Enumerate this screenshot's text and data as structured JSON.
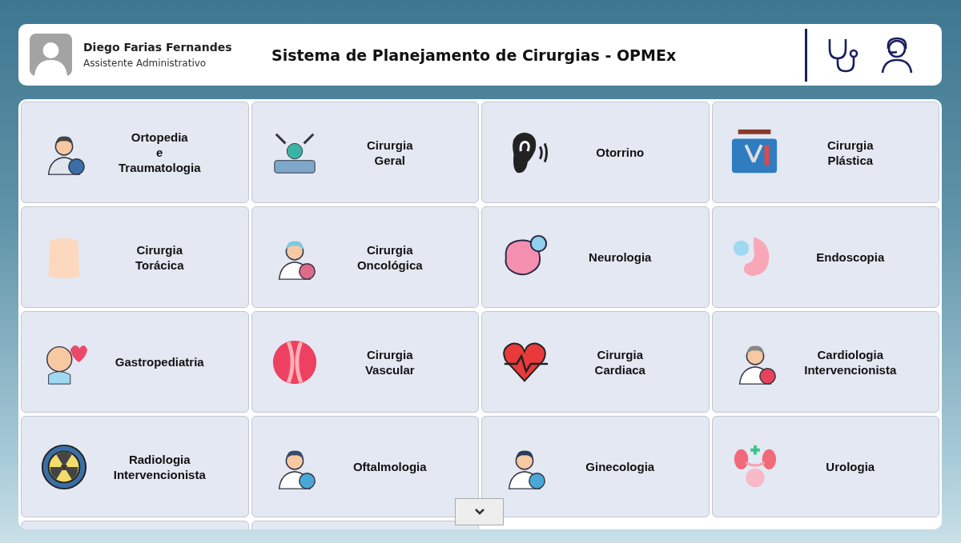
{
  "user": {
    "name": "Diego Farias Fernandes",
    "role": "Assistente Administrativo"
  },
  "header": {
    "title": "Sistema de Planejamento de Cirurgias - OPMEx"
  },
  "specialties": [
    {
      "label": "Ortopedia\ne\nTraumatologia"
    },
    {
      "label": "Cirurgia\nGeral"
    },
    {
      "label": "Otorrino"
    },
    {
      "label": "Cirurgia\nPlástica"
    },
    {
      "label": "Cirurgia\nTorácica"
    },
    {
      "label": "Cirurgia\nOncológica"
    },
    {
      "label": "Neurologia"
    },
    {
      "label": "Endoscopia"
    },
    {
      "label": "Gastropediatria"
    },
    {
      "label": "Cirurgia\nVascular"
    },
    {
      "label": "Cirurgia\nCardiaca"
    },
    {
      "label": "Cardiologia\nIntervencionista"
    },
    {
      "label": "Radiologia\nIntervencionista"
    },
    {
      "label": "Oftalmologia"
    },
    {
      "label": "Ginecologia"
    },
    {
      "label": "Urologia"
    }
  ]
}
